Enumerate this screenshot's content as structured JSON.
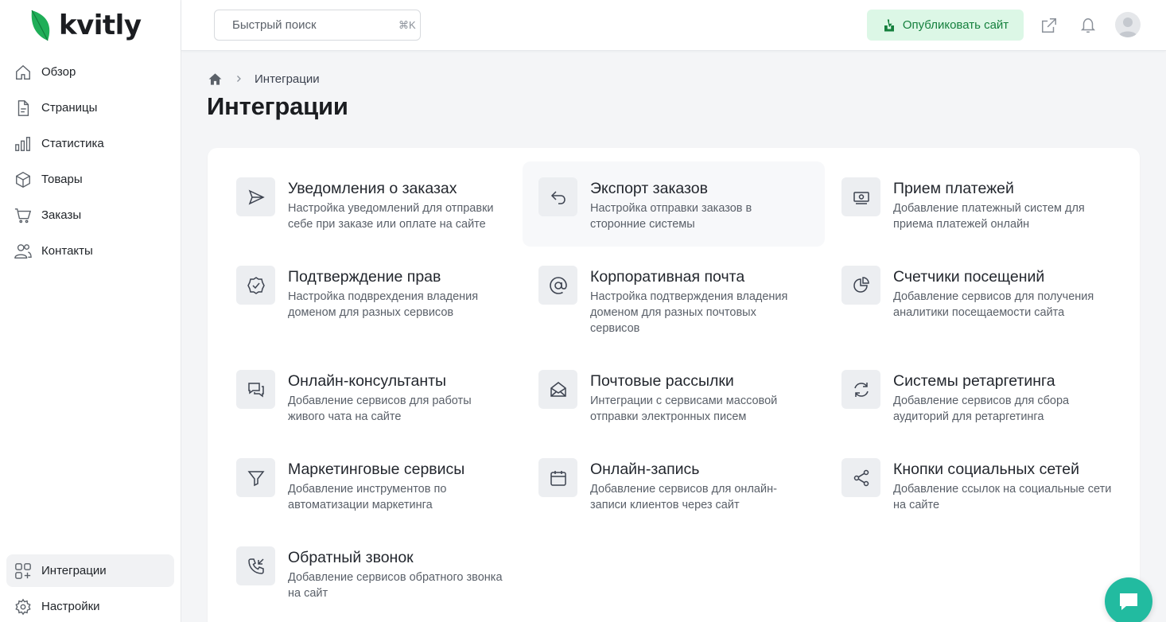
{
  "app": {
    "logo_text": "kvitly"
  },
  "sidebar": {
    "items": [
      {
        "label": "Обзор",
        "icon": "home-icon"
      },
      {
        "label": "Страницы",
        "icon": "file-icon"
      },
      {
        "label": "Статистика",
        "icon": "bar-chart-icon"
      },
      {
        "label": "Товары",
        "icon": "box-icon"
      },
      {
        "label": "Заказы",
        "icon": "cart-icon"
      },
      {
        "label": "Контакты",
        "icon": "users-icon"
      }
    ],
    "bottom_items": [
      {
        "label": "Интеграции",
        "icon": "grid-plus-icon",
        "active": true
      },
      {
        "label": "Настройки",
        "icon": "gear-icon"
      }
    ]
  },
  "topbar": {
    "search_placeholder": "Быстрый поиск",
    "search_shortcut": "⌘K",
    "publish_label": "Опубликовать сайт"
  },
  "breadcrumb": {
    "current": "Интеграции"
  },
  "page": {
    "title": "Интеграции"
  },
  "integrations": [
    {
      "title": "Уведомления о заказах",
      "desc": "Настройка уведомлений для отправки себе при заказе или оплате на сайте",
      "icon": "send-icon"
    },
    {
      "title": "Экспорт заказов",
      "desc": "Настройка отправки заказов в сторонние системы",
      "icon": "undo-arrow-icon"
    },
    {
      "title": "Прием платежей",
      "desc": "Добавление платежный систем для приема платежей онлайн",
      "icon": "money-icon"
    },
    {
      "title": "Подтверждение прав",
      "desc": "Настройка подврехдения владения доменом для разных сервисов",
      "icon": "check-badge-icon"
    },
    {
      "title": "Корпоративная почта",
      "desc": "Настройка подтверждения владения доменом для разных почтовых сервисов",
      "icon": "at-sign-icon"
    },
    {
      "title": "Счетчики посещений",
      "desc": "Добавление сервисов для получения аналитики посещаемости сайта",
      "icon": "pie-chart-icon"
    },
    {
      "title": "Онлайн-консультанты",
      "desc": "Добавление сервисов для работы живого чата на сайте",
      "icon": "chat-bubbles-icon"
    },
    {
      "title": "Почтовые рассылки",
      "desc": "Интеграции с сервисами массовой отправки электронных писем",
      "icon": "envelope-open-icon"
    },
    {
      "title": "Системы ретаргетинга",
      "desc": "Добавление сервисов для сбора аудиторий для ретаргетинга",
      "icon": "refresh-icon"
    },
    {
      "title": "Маркетинговые сервисы",
      "desc": "Добавление инструментов по автоматизации маркетинга",
      "icon": "funnel-icon"
    },
    {
      "title": "Онлайн-запись",
      "desc": "Добавление сервисов для онлайн-записи клиентов через сайт",
      "icon": "calendar-icon"
    },
    {
      "title": "Кнопки социальных сетей",
      "desc": "Добавление ссылок на социальные сети на сайте",
      "icon": "share-icon"
    },
    {
      "title": "Обратный звонок",
      "desc": "Добавление сервисов обратного звонка на сайт",
      "icon": "phone-incoming-icon"
    }
  ],
  "colors": {
    "accent_green": "#15803d",
    "publish_bg": "#dcf7e6",
    "chat_bubble": "#22bba0",
    "logo_leaf": "#1fae58"
  }
}
